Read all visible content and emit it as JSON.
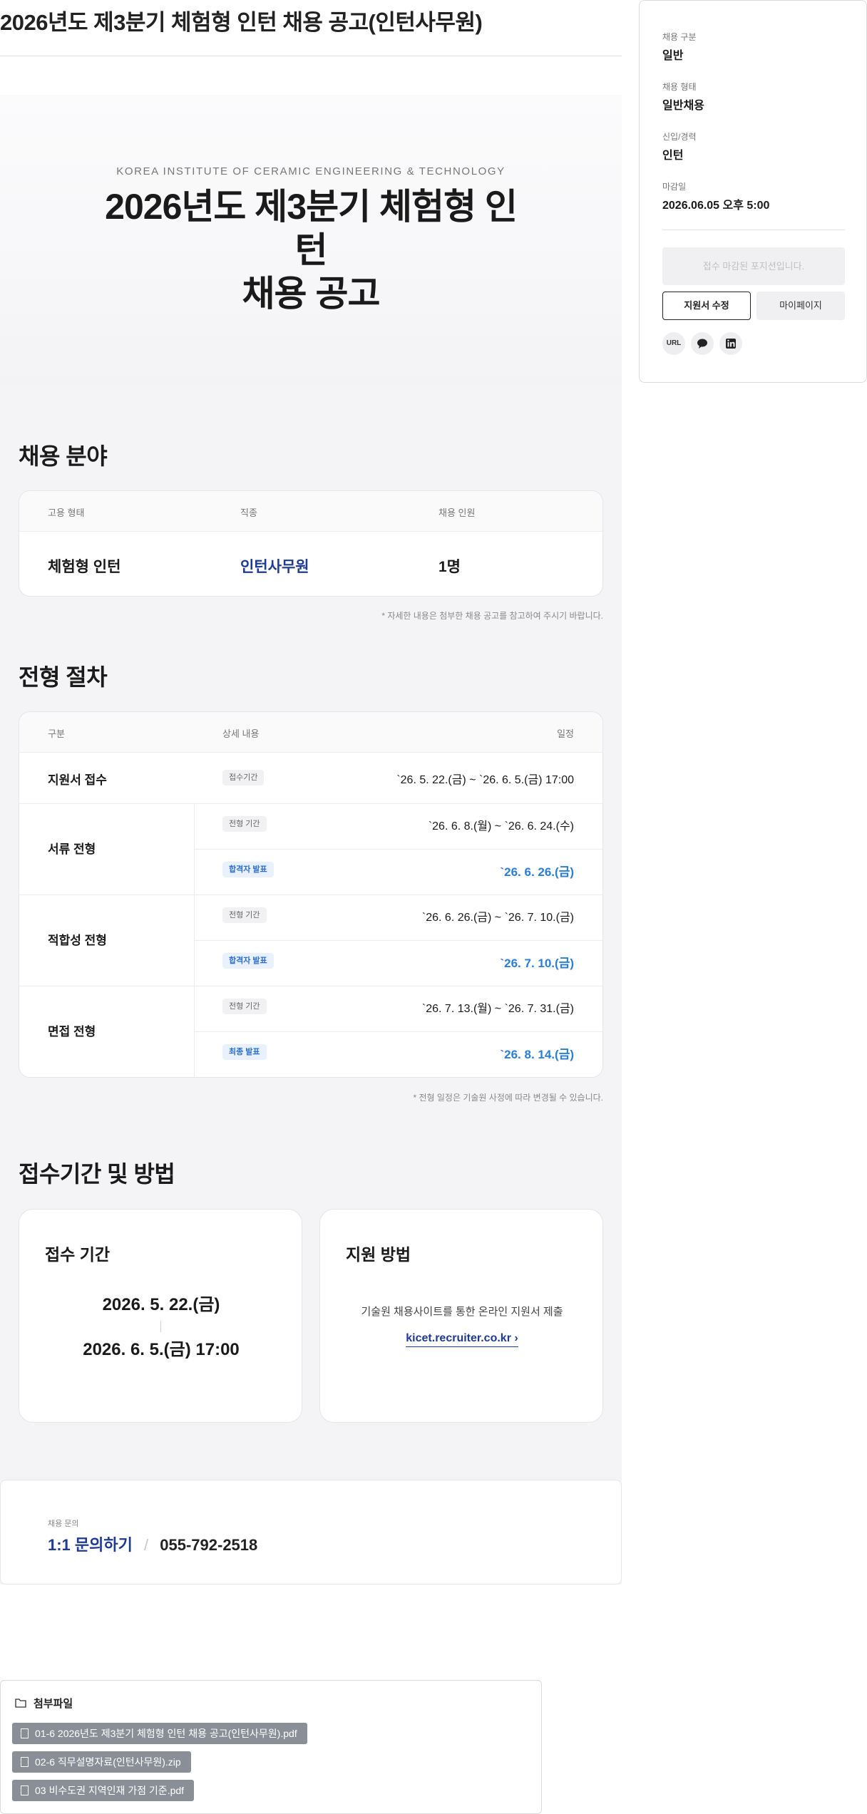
{
  "page_title": "2026년도 제3분기 체험형 인턴 채용 공고(인턴사무원)",
  "hero": {
    "eyebrow": "KOREA INSTITUTE OF CERAMIC ENGINEERING & TECHNOLOGY",
    "title_line1": "2026년도 제3분기 체험형 인턴",
    "title_line2": "채용 공고"
  },
  "recruit_field": {
    "title": "채용 분야",
    "headers": [
      "고용 형태",
      "직종",
      "채용 인원"
    ],
    "row": [
      "체험형 인턴",
      "인턴사무원",
      "1명"
    ],
    "note": "* 자세한 내용은 첨부한 채용 공고를 참고하여 주시기 바랍니다."
  },
  "process": {
    "title": "전형 절차",
    "headers": [
      "구분",
      "상세 내용",
      "일정"
    ],
    "stages": [
      {
        "name": "지원서 접수",
        "rows": [
          {
            "badge": "접수기간",
            "date": "`26. 5. 22.(금) ~ `26. 6. 5.(금) 17:00",
            "highlight": false
          }
        ]
      },
      {
        "name": "서류 전형",
        "rows": [
          {
            "badge": "전형 기간",
            "date": "`26. 6. 8.(월) ~ `26. 6. 24.(수)",
            "highlight": false
          },
          {
            "badge": "합격자 발표",
            "date": "`26. 6. 26.(금)",
            "highlight": true
          }
        ]
      },
      {
        "name": "적합성 전형",
        "rows": [
          {
            "badge": "전형 기간",
            "date": "`26. 6. 26.(금) ~ `26. 7. 10.(금)",
            "highlight": false
          },
          {
            "badge": "합격자 발표",
            "date": "`26. 7. 10.(금)",
            "highlight": true
          }
        ]
      },
      {
        "name": "면접 전형",
        "rows": [
          {
            "badge": "전형 기간",
            "date": "`26. 7. 13.(월) ~ `26. 7. 31.(금)",
            "highlight": false
          },
          {
            "badge": "최종 발표",
            "date": "`26. 8. 14.(금)",
            "highlight": true
          }
        ]
      }
    ],
    "note": "* 전형 일정은 기술원 사정에 따라 변경될 수 있습니다."
  },
  "apply": {
    "title": "접수기간 및 방법",
    "period_card": {
      "title": "접수 기간",
      "start": "2026. 5. 22.(금)",
      "end": "2026. 6. 5.(금) 17:00"
    },
    "method_card": {
      "title": "지원 방법",
      "desc": "기술원 채용사이트를 통한 온라인 지원서 제출",
      "link": "kicet.recruiter.co.kr ›"
    }
  },
  "contact": {
    "label": "채용 문의",
    "inquiry": "1:1 문의하기",
    "separator": "/",
    "phone": "055-792-2518"
  },
  "sidebar": {
    "fields": [
      {
        "label": "채용 구분",
        "value": "일반"
      },
      {
        "label": "채용 형태",
        "value": "일반채용"
      },
      {
        "label": "신입/경력",
        "value": "인턴"
      },
      {
        "label": "마감일",
        "value": "2026.06.05 오후 5:00"
      }
    ],
    "closed_button": "접수 마감된 포지션입니다.",
    "edit_button": "지원서 수정",
    "mypage_button": "마이페이지",
    "share": [
      {
        "label": "URL",
        "icon": "url-icon"
      },
      {
        "label": "",
        "icon": "chat-bubble-icon"
      },
      {
        "label": "in",
        "icon": "linkedin-icon"
      }
    ]
  },
  "attachments": {
    "title": "첨부파일",
    "files": [
      "01-6 2026년도 제3분기 체험형 인턴 채용 공고(인턴사무원).pdf",
      "02-6 직무설명자료(인턴사무원).zip",
      "03 비수도권 지역인재 가점 기준.pdf"
    ]
  },
  "colors": {
    "accent_navy": "#1f3a93",
    "accent_blue": "#2a7dd8",
    "background_gray": "#f4f4f6"
  }
}
